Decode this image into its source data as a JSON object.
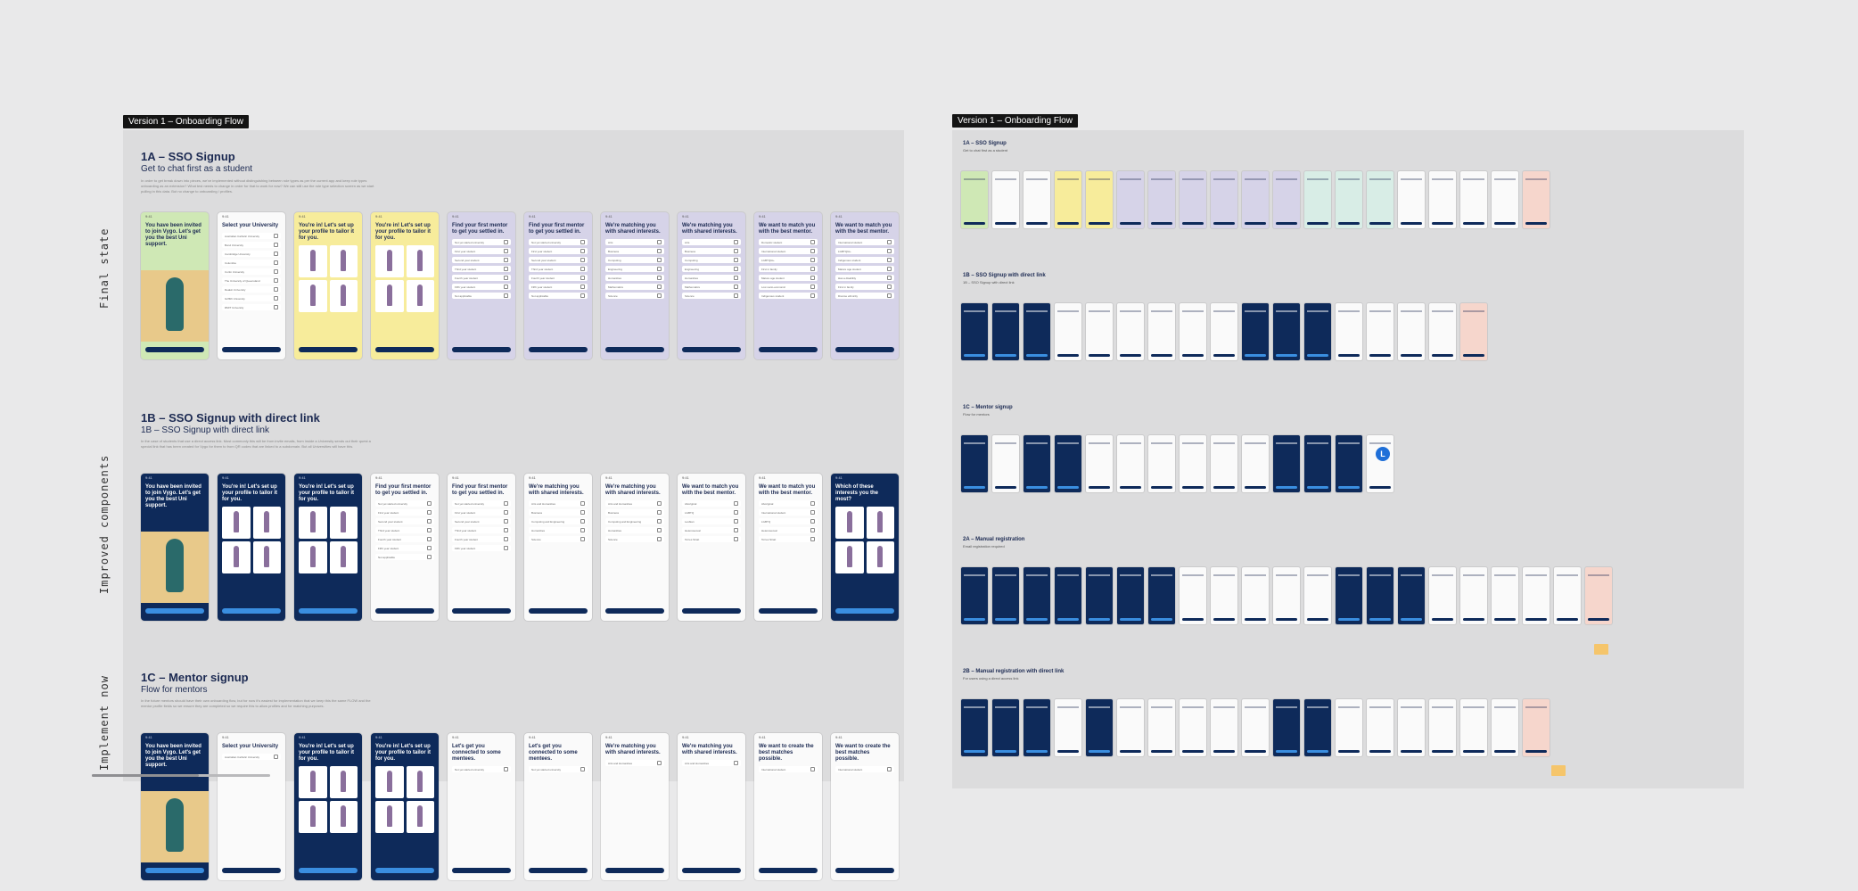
{
  "canvas": {
    "left_frame_tag": "Version 1 – Onboarding Flow",
    "right_frame_tag": "Version 1 – Onboarding Flow",
    "stage_labels": [
      "Final state",
      "Improved components",
      "Implement now"
    ]
  },
  "sections": [
    {
      "title": "1A – SSO Signup",
      "subtitle": "Get to chat first as a student",
      "desc": "In order to get break down into pieces, we've implemented without distinguishing between role types as per the current app and keep role types onboarding as an extension? What test needs to change in order for that to work for now? We can still use the role type selection screen as we start pulling in this data. But no change to onboarding / profiles."
    },
    {
      "title": "1B – SSO Signup with direct link",
      "subtitle": "1B – SSO Signup with direct link",
      "desc": "In the case of students that use a direct access link. Most commonly this will be from invite emails, from inside a University sends out their quest a special link that has been created for Vygo for them to from QR codes that are linked to a subdomain. But all Universities will have this."
    },
    {
      "title": "1C – Mentor signup",
      "subtitle": "Flow for mentors",
      "desc": "In the future mentors should have their own onboarding flow, but for now it's easiest for implementation that we keep this the same FLOW and the mentor profile fields so we ensure they are completed so we require this to allow profiles and for matching purposes."
    }
  ],
  "row_1a": [
    {
      "theme": "green",
      "title": "You have been invited to join Vygo. Let's get you the best Uni support."
    },
    {
      "theme": "white",
      "title": "Select your University",
      "options": [
        "Australian Catholic University",
        "Bond University",
        "Cambridge University",
        "Columbia",
        "Curtin University",
        "The University of Queensland",
        "Deakin University",
        "Griffith University",
        "RMIT University"
      ]
    },
    {
      "theme": "yellow",
      "title": "You're in! Let's set up your profile to tailor it for you."
    },
    {
      "theme": "yellow",
      "title": "You're in! Let's set up your profile to tailor it for you."
    },
    {
      "theme": "lavender",
      "title": "Find your first mentor to get you settled in.",
      "options": [
        "Not yet started university",
        "First year student",
        "Second year student",
        "Third year student",
        "Fourth year student",
        "Fifth year student",
        "Not applicable"
      ]
    },
    {
      "theme": "lavender",
      "title": "Find your first mentor to get you settled in.",
      "options": [
        "Not yet started university",
        "First year student",
        "Second year student",
        "Third year student",
        "Fourth year student",
        "Fifth year student",
        "Not applicable"
      ]
    },
    {
      "theme": "lavender",
      "title": "We're matching you with shared interests.",
      "options": [
        "Arts",
        "Business",
        "Computing",
        "Engineering",
        "Humanities",
        "Mathematics",
        "Science"
      ]
    },
    {
      "theme": "lavender",
      "title": "We're matching you with shared interests.",
      "options": [
        "Arts",
        "Business",
        "Computing",
        "Engineering",
        "Humanities",
        "Mathematics",
        "Science"
      ]
    },
    {
      "theme": "lavender",
      "title": "We want to match you with the best mentor.",
      "options": [
        "Domestic student",
        "International student",
        "LGBTQIA+",
        "First in family",
        "Mature age student",
        "Low socio-economic",
        "Indigenous student"
      ]
    },
    {
      "theme": "lavender",
      "title": "We want to match you with the best mentor.",
      "options": [
        "International student",
        "LGBTQIA+",
        "Indigenous student",
        "Mature age student",
        "Has a disability",
        "First in family",
        "Diverse ethnicity"
      ]
    }
  ],
  "row_1b": [
    {
      "theme": "navy",
      "title": "You have been invited to join Vygo. Let's get you the best Uni support."
    },
    {
      "theme": "navy",
      "title": "You're in! Let's set up your profile to tailor it for you."
    },
    {
      "theme": "navy",
      "title": "You're in! Let's set up your profile to tailor it for you."
    },
    {
      "theme": "white",
      "title": "Find your first mentor to get you settled in.",
      "options": [
        "Not yet started university",
        "First year student",
        "Second year student",
        "Third year student",
        "Fourth year student",
        "Fifth year student",
        "Not applicable"
      ]
    },
    {
      "theme": "white",
      "title": "Find your first mentor to get you settled in.",
      "options": [
        "Not yet started university",
        "First year student",
        "Second year student",
        "Third year student",
        "Fourth year student",
        "Fifth year student"
      ]
    },
    {
      "theme": "white",
      "title": "We're matching you with shared interests.",
      "options": [
        "Arts and Humanities",
        "Business",
        "Computing and Engineering",
        "Humanities",
        "Science"
      ]
    },
    {
      "theme": "white",
      "title": "We're matching you with shared interests.",
      "options": [
        "Arts and Humanities",
        "Business",
        "Computing and Engineering",
        "Humanities",
        "Science"
      ]
    },
    {
      "theme": "white",
      "title": "We want to match you with the best mentor.",
      "options": [
        "Aboriginal",
        "LGBTQ",
        "Lesbian",
        "Heterosexual",
        "Torres Strait"
      ]
    },
    {
      "theme": "white",
      "title": "We want to match you with the best mentor.",
      "options": [
        "Aboriginal",
        "International student",
        "LGBTQ",
        "Heterosexual",
        "Torres Strait"
      ]
    },
    {
      "theme": "navy",
      "title": "Which of these interests you the most?"
    }
  ],
  "row_1c": [
    {
      "theme": "navy",
      "title": "You have been invited to join Vygo. Let's get you the best Uni support."
    },
    {
      "theme": "white",
      "title": "Select your University",
      "options": [
        "Australian Catholic University"
      ]
    },
    {
      "theme": "navy",
      "title": "You're in! Let's set up your profile to tailor it for you."
    },
    {
      "theme": "navy",
      "title": "You're in! Let's set up your profile to tailor it for you."
    },
    {
      "theme": "white",
      "title": "Let's get you connected to some mentees.",
      "options": [
        "Not yet started university"
      ]
    },
    {
      "theme": "white",
      "title": "Let's get you connected to some mentees.",
      "options": [
        "Not yet started university"
      ]
    },
    {
      "theme": "white",
      "title": "We're matching you with shared interests.",
      "options": [
        "Arts and Humanities"
      ]
    },
    {
      "theme": "white",
      "title": "We're matching you with shared interests.",
      "options": [
        "Arts and Humanities"
      ]
    },
    {
      "theme": "white",
      "title": "We want to create the best matches possible.",
      "options": [
        "International student"
      ]
    },
    {
      "theme": "white",
      "title": "We want to create the best matches possible.",
      "options": [
        "International student"
      ]
    }
  ],
  "overview_rows": [
    {
      "title": "1A – SSO Signup",
      "subtitle": "Get to chat first as a student",
      "themes": [
        "green",
        "white",
        "white",
        "yellow",
        "yellow",
        "lavender",
        "lavender",
        "lavender",
        "lavender",
        "lavender",
        "lavender",
        "teal",
        "teal",
        "teal",
        "white",
        "white",
        "white",
        "white",
        "pink"
      ]
    },
    {
      "title": "1B – SSO Signup with direct link",
      "subtitle": "1B – SSO Signup with direct link",
      "themes": [
        "navy",
        "navy",
        "navy",
        "white",
        "white",
        "white",
        "white",
        "white",
        "white",
        "navy",
        "navy",
        "navy",
        "white",
        "white",
        "white",
        "white",
        "pink"
      ]
    },
    {
      "title": "1C – Mentor signup",
      "subtitle": "Flow for mentors",
      "themes": [
        "navy",
        "white",
        "navy",
        "navy",
        "white",
        "white",
        "white",
        "white",
        "white",
        "white",
        "navy",
        "navy",
        "navy",
        "white"
      ]
    },
    {
      "title": "2A – Manual registration",
      "subtitle": "Email registration required",
      "themes": [
        "navy",
        "navy",
        "navy",
        "navy",
        "navy",
        "navy",
        "navy",
        "white",
        "white",
        "white",
        "white",
        "white",
        "navy",
        "navy",
        "navy",
        "white",
        "white",
        "white",
        "white",
        "white",
        "pink"
      ]
    },
    {
      "title": "2B – Manual registration with direct link",
      "subtitle": "For users using a direct access link",
      "themes": [
        "navy",
        "navy",
        "navy",
        "white",
        "navy",
        "white",
        "white",
        "white",
        "white",
        "white",
        "navy",
        "navy",
        "white",
        "white",
        "white",
        "white",
        "white",
        "white",
        "pink"
      ]
    }
  ],
  "collaborator": {
    "initial": "L",
    "color": "#1f6fd8"
  }
}
